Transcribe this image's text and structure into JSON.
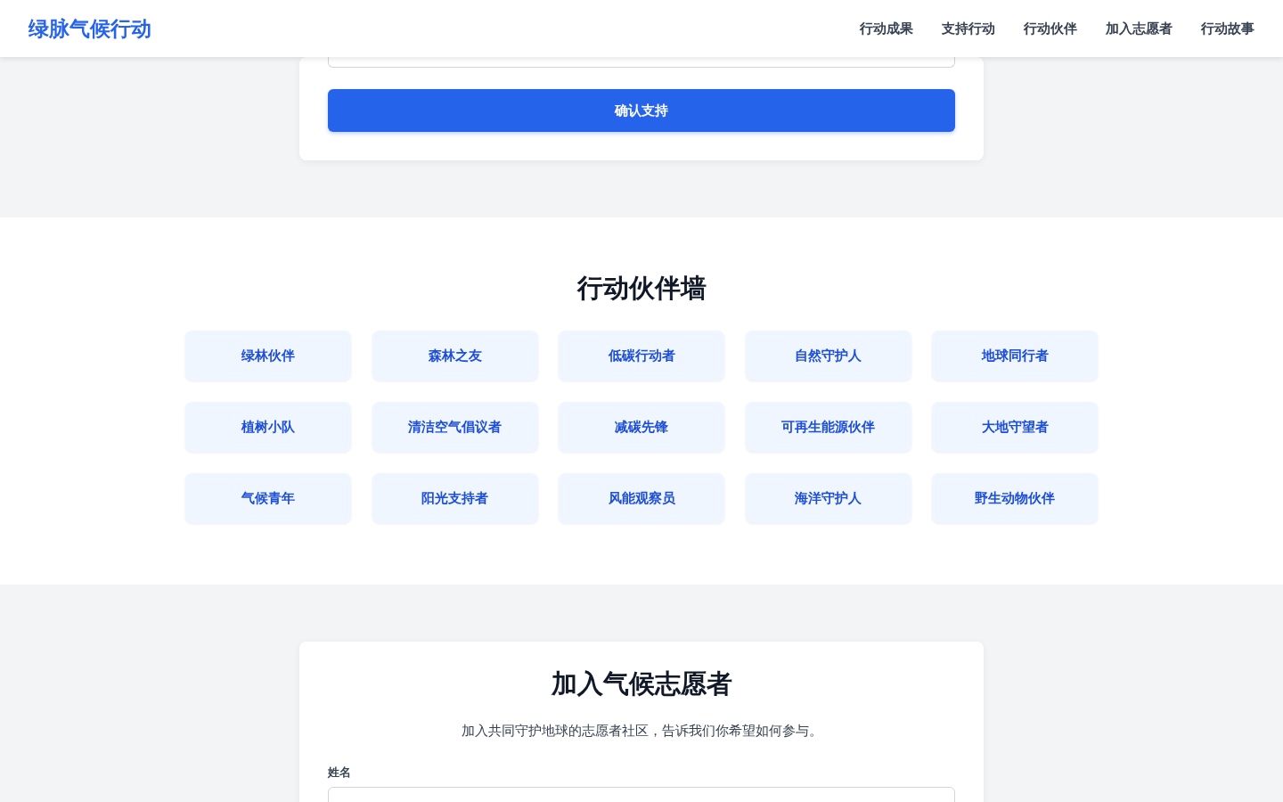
{
  "navbar": {
    "brand": "绿脉气候行动",
    "links": [
      "行动成果",
      "支持行动",
      "行动伙伴",
      "加入志愿者",
      "行动故事"
    ]
  },
  "support_form": {
    "submit_button": "确认支持"
  },
  "partner_wall": {
    "title": "行动伙伴墙",
    "partners": [
      "绿林伙伴",
      "森林之友",
      "低碳行动者",
      "自然守护人",
      "地球同行者",
      "植树小队",
      "清洁空气倡议者",
      "减碳先锋",
      "可再生能源伙伴",
      "大地守望者",
      "气候青年",
      "阳光支持者",
      "风能观察员",
      "海洋守护人",
      "野生动物伙伴"
    ]
  },
  "volunteer_form": {
    "title": "加入气候志愿者",
    "description": "加入共同守护地球的志愿者社区，告诉我们你希望如何参与。",
    "fields": [
      {
        "label": "姓名"
      }
    ]
  }
}
